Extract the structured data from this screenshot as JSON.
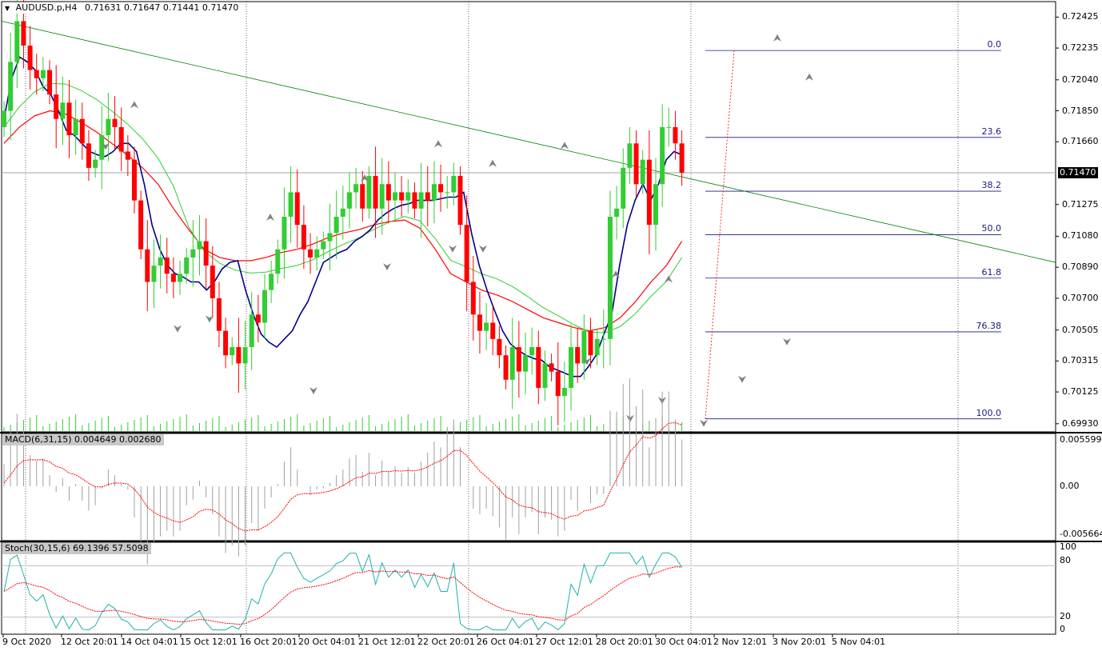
{
  "header": {
    "symbol": "AUDUSD.p,H4",
    "ohlc": "0.71631 0.71647 0.71441 0.71470",
    "current_price": "0.71470"
  },
  "panels": {
    "macd_title": "MACD(6,31,15) 0.004649 0.002680",
    "stoch_title": "Stoch(30,15,6) 69.1396 57.5098"
  },
  "axes": {
    "price_ticks": [
      "0.72425",
      "0.72235",
      "0.72040",
      "0.71850",
      "0.71660",
      "0.71275",
      "0.71080",
      "0.70890",
      "0.70700",
      "0.70505",
      "0.70315",
      "0.70125",
      "0.69930"
    ],
    "macd_ticks": [
      "0.005599",
      "0.00",
      "-0.005664"
    ],
    "stoch_ticks": [
      "100",
      "80",
      "20",
      "0"
    ],
    "time_ticks": [
      "9 Oct 2020",
      "12 Oct 20:01",
      "14 Oct 04:01",
      "15 Oct 12:01",
      "16 Oct 20:01",
      "20 Oct 04:01",
      "21 Oct 12:01",
      "22 Oct 20:01",
      "26 Oct 04:01",
      "27 Oct 12:01",
      "28 Oct 20:01",
      "30 Oct 04:01",
      "2 Nov 12:01",
      "3 Nov 20:01",
      "5 Nov 04:01"
    ]
  },
  "fibonacci": {
    "levels": [
      "0.0",
      "23.6",
      "38.2",
      "50.0",
      "61.8",
      "76.38",
      "100.0"
    ],
    "high": 0.7222,
    "low": 0.6996
  },
  "colors": {
    "bull": "#32cd32",
    "bear": "#ff0000",
    "fast_ma": "#00008b",
    "slow_ma": "#ff0000",
    "mid_ma": "#32cd32",
    "trendline": "#008000",
    "fib_line": "#1a1a80",
    "macd_hist": "#a0a0a0",
    "macd_signal": "#ff0000",
    "stoch_main": "#20b2aa",
    "stoch_signal": "#ff0000"
  },
  "chart_data": {
    "type": "candlestick",
    "timeframe": "H4",
    "ylim": [
      0.6988,
      0.7252
    ],
    "closes": [
      0.7185,
      0.7215,
      0.724,
      0.7225,
      0.721,
      0.7205,
      0.721,
      0.7195,
      0.718,
      0.719,
      0.717,
      0.718,
      0.7165,
      0.715,
      0.7155,
      0.717,
      0.718,
      0.7175,
      0.716,
      0.7155,
      0.713,
      0.71,
      0.708,
      0.709,
      0.7095,
      0.7085,
      0.708,
      0.7085,
      0.7095,
      0.71,
      0.7105,
      0.709,
      0.707,
      0.705,
      0.7035,
      0.704,
      0.703,
      0.704,
      0.706,
      0.7055,
      0.7075,
      0.7085,
      0.71,
      0.712,
      0.7135,
      0.7115,
      0.71,
      0.7095,
      0.71,
      0.7105,
      0.711,
      0.712,
      0.7125,
      0.7135,
      0.714,
      0.7125,
      0.7145,
      0.7125,
      0.714,
      0.713,
      0.7135,
      0.713,
      0.7135,
      0.7125,
      0.7135,
      0.713,
      0.714,
      0.7135,
      0.7135,
      0.7145,
      0.7115,
      0.708,
      0.706,
      0.705,
      0.7055,
      0.7045,
      0.7035,
      0.702,
      0.704,
      0.7025,
      0.7035,
      0.704,
      0.7015,
      0.703,
      0.7025,
      0.701,
      0.7015,
      0.704,
      0.703,
      0.705,
      0.7035,
      0.7045,
      0.7045,
      0.712,
      0.7125,
      0.715,
      0.7165,
      0.714,
      0.7155,
      0.7115,
      0.714,
      0.7175,
      0.7175,
      0.7165,
      0.7147
    ],
    "fast_ma": [
      0.718,
      0.7205,
      0.7218,
      0.7215,
      0.721,
      0.72,
      0.7195,
      0.7185,
      0.7173,
      0.717,
      0.7165,
      0.716,
      0.7158,
      0.7157,
      0.716,
      0.7165,
      0.7165,
      0.716,
      0.714,
      0.7115,
      0.71,
      0.709,
      0.7085,
      0.7083,
      0.708,
      0.708,
      0.7075,
      0.708,
      0.7088,
      0.7092,
      0.7093,
      0.7075,
      0.706,
      0.7048,
      0.7043,
      0.704,
      0.7045,
      0.705,
      0.706,
      0.7068,
      0.708,
      0.7092,
      0.7095,
      0.7098,
      0.71,
      0.7105,
      0.7108,
      0.7112,
      0.7118,
      0.7122,
      0.7125,
      0.7127,
      0.7128,
      0.713,
      0.713,
      0.713,
      0.7131,
      0.7132,
      0.7132,
      0.7135,
      0.711,
      0.709,
      0.7075,
      0.7062,
      0.705,
      0.7042,
      0.7038,
      0.7035,
      0.7033,
      0.7032,
      0.7028,
      0.7026,
      0.7024,
      0.7022,
      0.7022,
      0.7028,
      0.7035,
      0.7048,
      0.706,
      0.709,
      0.7115,
      0.713,
      0.714,
      0.713,
      0.714,
      0.7155,
      0.716,
      0.7158
    ],
    "slow_ma": [
      0.7165,
      0.7175,
      0.7182,
      0.7185,
      0.7183,
      0.7178,
      0.7172,
      0.7165,
      0.7158,
      0.715,
      0.714,
      0.7125,
      0.7112,
      0.71,
      0.7095,
      0.7093,
      0.7093,
      0.7095,
      0.7098,
      0.71,
      0.7103,
      0.7107,
      0.711,
      0.7112,
      0.7115,
      0.7117,
      0.7118,
      0.7113,
      0.71,
      0.7085,
      0.708,
      0.7075,
      0.7072,
      0.7068,
      0.7063,
      0.7058,
      0.7055,
      0.7052,
      0.705,
      0.7052,
      0.7058,
      0.7068,
      0.708,
      0.709,
      0.7105
    ]
  }
}
